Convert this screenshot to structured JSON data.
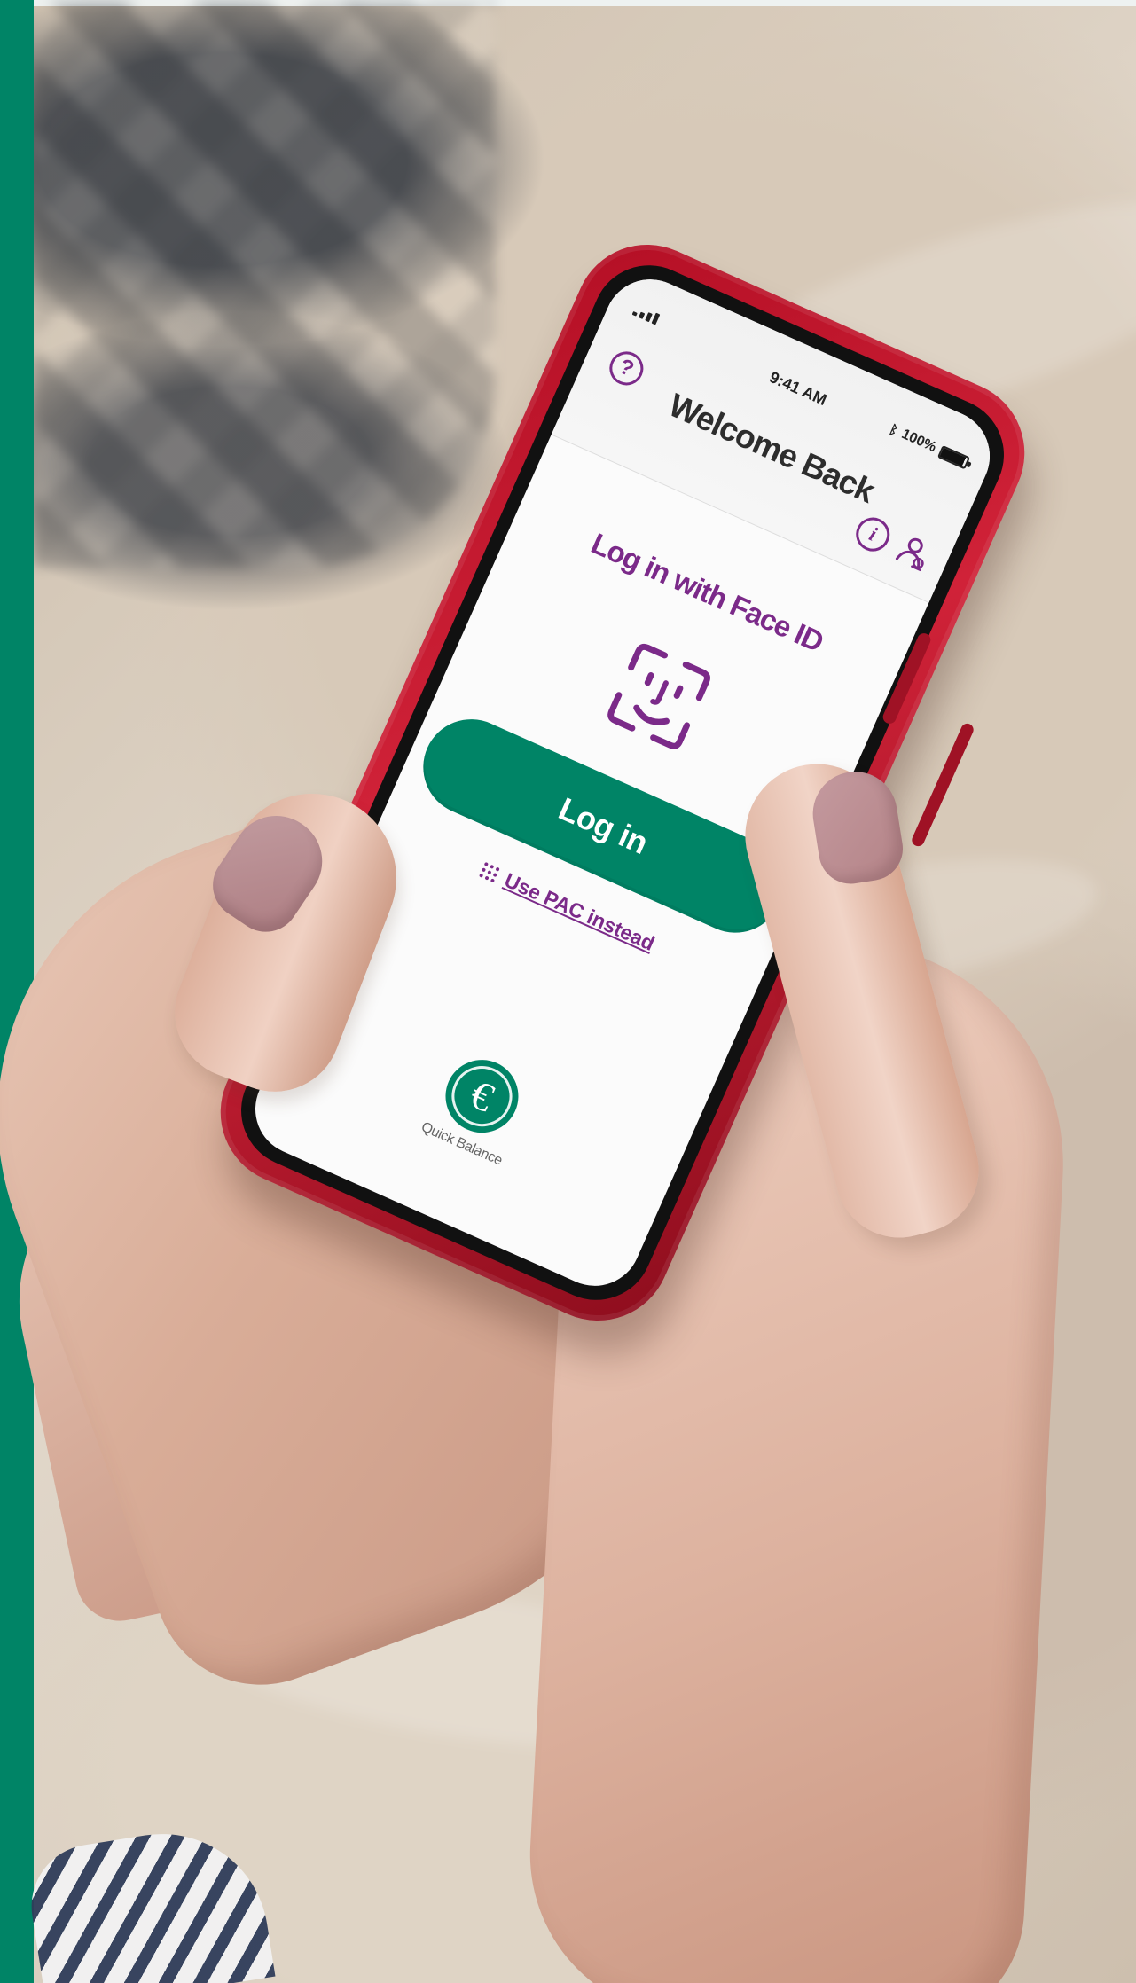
{
  "status_bar": {
    "time": "9:41 AM",
    "battery": "100%",
    "bluetooth_icon": "bluetooth-icon",
    "signal_icon": "signal-icon",
    "battery_icon": "battery-icon"
  },
  "header": {
    "title": "Welcome Back",
    "help_icon": "help-icon",
    "info_icon": "info-icon",
    "profile_icon": "profile-icon"
  },
  "login": {
    "face_id_title": "Log in with Face ID",
    "face_id_icon": "face-id-icon",
    "button_label": "Log in",
    "pac_label": "Use PAC instead",
    "pac_icon": "keypad-icon"
  },
  "quick_balance": {
    "label": "Quick Balance",
    "icon": "euro-icon"
  },
  "colors": {
    "brand_green": "#008466",
    "accent_purple": "#7B2A89",
    "case_red": "#C81D32"
  }
}
